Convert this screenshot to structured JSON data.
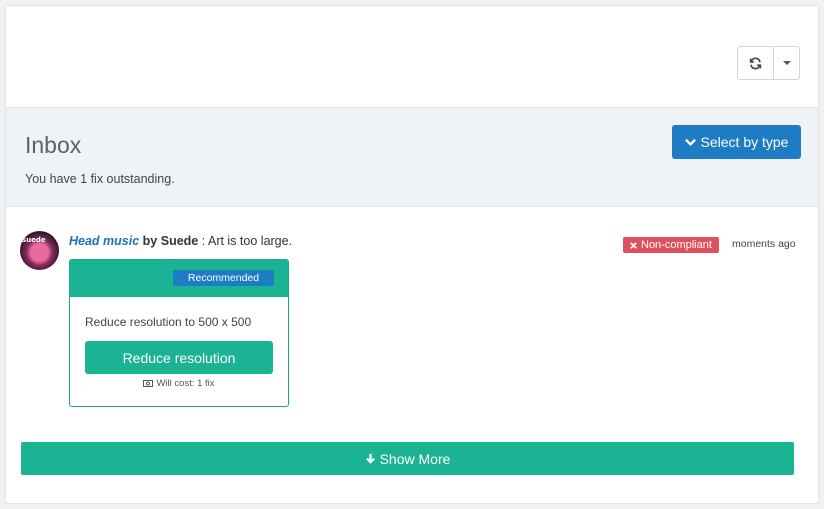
{
  "toolbar": {
    "refresh_icon": "refresh-icon",
    "dropdown_icon": "caret-down-icon"
  },
  "inbox": {
    "title": "Inbox",
    "subtitle": "You have 1 fix outstanding.",
    "select_by_type_label": "Select by type"
  },
  "item": {
    "title": "Head music",
    "by_label": "by",
    "artist": "Suede",
    "issue": ": Art is too large.",
    "status_badge": "Non-compliant",
    "timestamp": "moments ago",
    "avatar_text": "suede",
    "fix": {
      "badge": "Recommended",
      "description": "Reduce resolution to 500 x 500",
      "button_label": "Reduce resolution",
      "cost": "Will cost: 1 fix"
    }
  },
  "show_more_label": "Show More",
  "colors": {
    "accent_green": "#1ab394",
    "primary_blue": "#1e7cc4",
    "danger_red": "#e0505c",
    "header_bg": "#eef3f8"
  }
}
